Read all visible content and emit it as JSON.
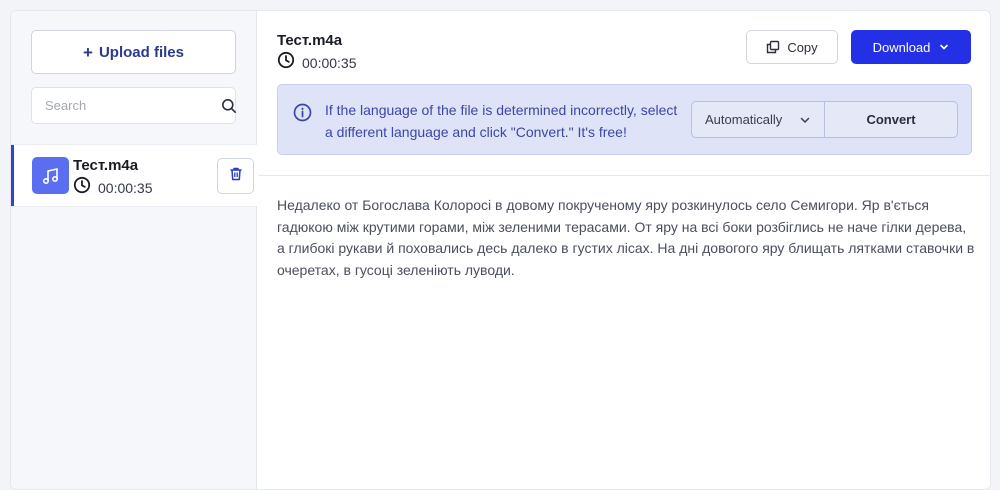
{
  "sidebar": {
    "upload_label": "Upload files",
    "search_placeholder": "Search",
    "files": [
      {
        "name": "Тест.m4a",
        "duration": "00:00:35"
      }
    ]
  },
  "main": {
    "file_name": "Тест.m4a",
    "duration": "00:00:35",
    "copy_label": "Copy",
    "download_label": "Download",
    "info_text": "If the language of the file is determined incorrectly, select a different language and click \"Convert.\" It's free!",
    "language_selected": "Automatically",
    "convert_label": "Convert",
    "transcript": "Недалеко от Богослава Колоросі в довому покрученому яру розкинулось село Семигори. Яр в'ється гадюкою між крутими горами, між зеленими терасами. От яру на всі боки розбіглись не наче гілки дерева, а глибокі рукави й поховались десь далеко в густих лісах. На дні довогого яру блищать лятками ставочки в очеретах, в гусоці зеленіють луводи."
  },
  "colors": {
    "accent": "#2f44d6",
    "primary_button": "#2330e6",
    "banner_bg": "#dfe3f7",
    "banner_text": "#3b46a8",
    "thumb_bg": "#5b6ef0"
  }
}
